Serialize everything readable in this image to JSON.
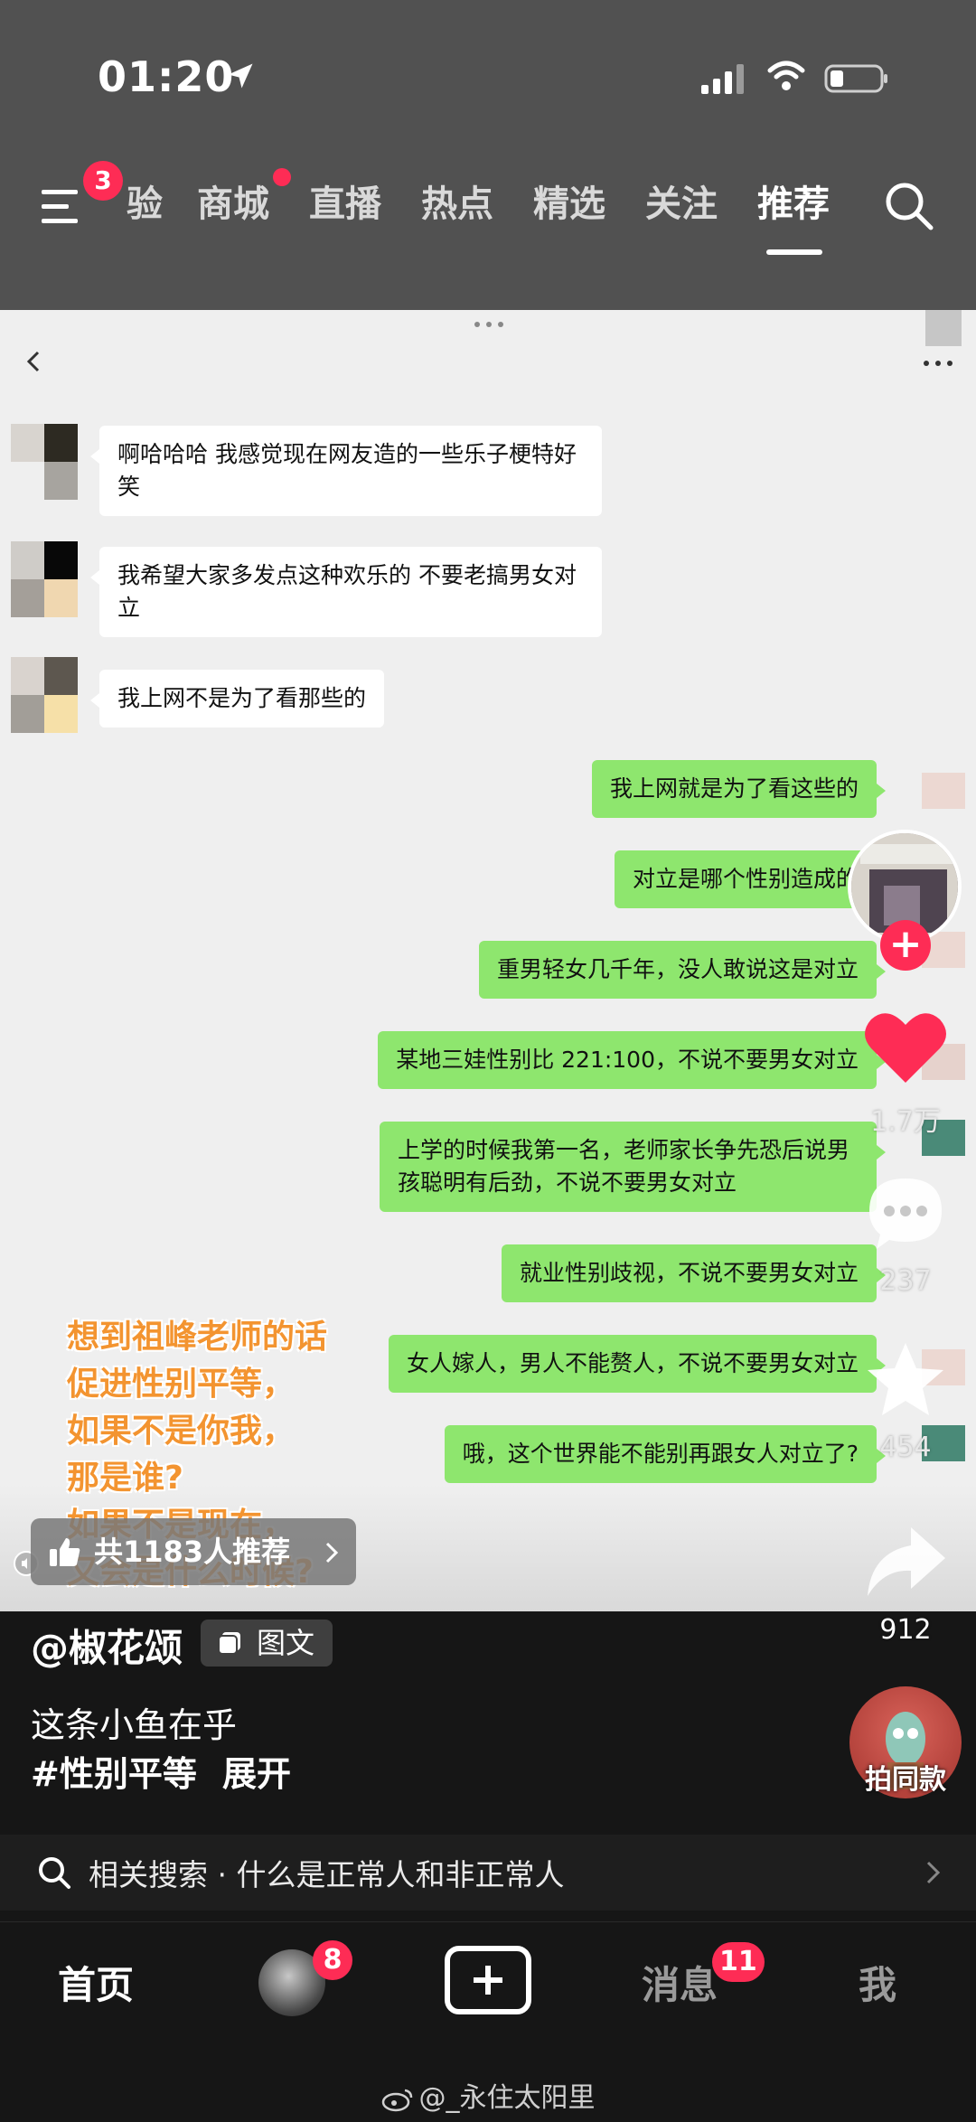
{
  "status_bar": {
    "time": "01:20"
  },
  "nav": {
    "menu_badge": "3",
    "tabs": [
      "验",
      "商城",
      "直播",
      "热点",
      "精选",
      "关注",
      "推荐"
    ],
    "active_tab": "推荐"
  },
  "chat": {
    "messages_left": [
      "啊哈哈哈 我感觉现在网友造的一些乐子梗特好笑",
      "我希望大家多发点这种欢乐的 不要老搞男女对立",
      "我上网不是为了看那些的"
    ],
    "messages_right": [
      "我上网就是为了看这些的",
      "对立是哪个性别造成的",
      "重男轻女几千年，没人敢说这是对立",
      "某地三娃性别比 221:100，不说不要男女对立",
      "上学的时候我第一名，老师家长争先恐后说男孩聪明有后劲，不说不要男女对立",
      "就业性别歧视，不说不要男女对立",
      "女人嫁人，男人不能赘人，不说不要男女对立",
      "哦，这个世界能不能别再跟女人对立了?"
    ]
  },
  "overlay": {
    "lines": [
      "想到祖峰老师的话",
      "促进性别平等，",
      "如果不是你我，",
      "那是谁?",
      "如果不是现在，",
      "又会是什么时候?"
    ]
  },
  "recommend": {
    "label": "共1183人推荐"
  },
  "rail": {
    "like_count": "1.7万",
    "comment_count": "237",
    "favorite_count": "454",
    "share_count": "912",
    "same_style_label": "拍同款"
  },
  "post": {
    "author": "@椒花颂",
    "type_badge": "图文",
    "caption_line1": "这条小鱼在乎",
    "hashtag": "#性别平等",
    "expand": "展开"
  },
  "related_search": {
    "label": "相关搜索 · 什么是正常人和非正常人"
  },
  "tabbar": {
    "home": "首页",
    "friend_badge": "8",
    "messages": "消息",
    "messages_badge": "11",
    "me": "我"
  },
  "watermark": {
    "text": "@_永住太阳里"
  },
  "colors": {
    "accent": "#fe2c55",
    "bubble_green": "#8ee66e",
    "overlay_orange": "#f39430"
  }
}
